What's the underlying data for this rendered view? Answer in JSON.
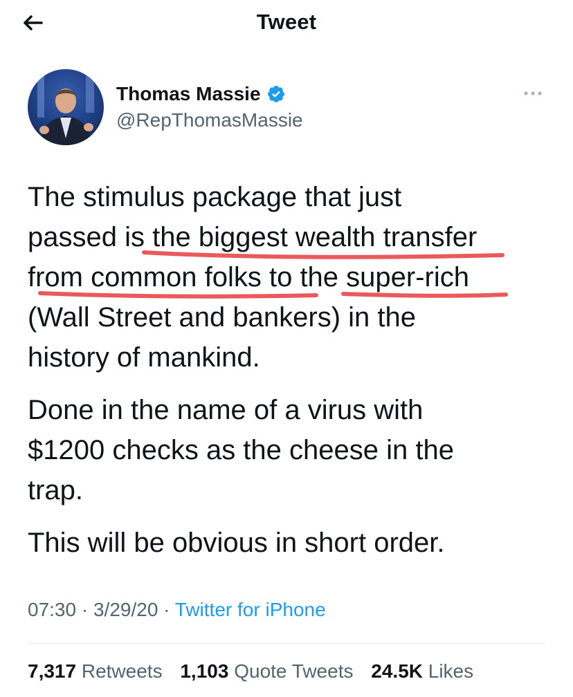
{
  "header": {
    "title": "Tweet",
    "back_icon": "arrow-left-icon"
  },
  "tweet": {
    "author": {
      "name": "Thomas Massie",
      "handle": "@RepThomasMassie",
      "verified": true,
      "avatar_icon": "profile-photo"
    },
    "more_icon": "ellipsis-icon",
    "paragraphs": [
      {
        "lines": [
          "The stimulus package that just",
          "passed is the biggest wealth transfer",
          "from common folks to the super-rich",
          "(Wall Street and bankers) in the",
          "history of mankind."
        ]
      },
      {
        "lines": [
          "Done in the name of a virus with",
          "$1200 checks as the cheese in the",
          "trap."
        ]
      },
      {
        "lines": [
          "This will be obvious in short order."
        ]
      }
    ],
    "time": "07:30",
    "separator": "·",
    "date": "3/29/20",
    "source": "Twitter for iPhone",
    "stats": {
      "retweets_count": "7,317",
      "retweets_label": "Retweets",
      "quotes_count": "1,103",
      "quotes_label": "Quote Tweets",
      "likes_count": "24.5K",
      "likes_label": "Likes"
    }
  },
  "colors": {
    "text": "#0f1419",
    "secondary": "#536471",
    "link": "#1d9bf0",
    "verified": "#1d9bf0",
    "highlight_underline": "#e8484a"
  }
}
